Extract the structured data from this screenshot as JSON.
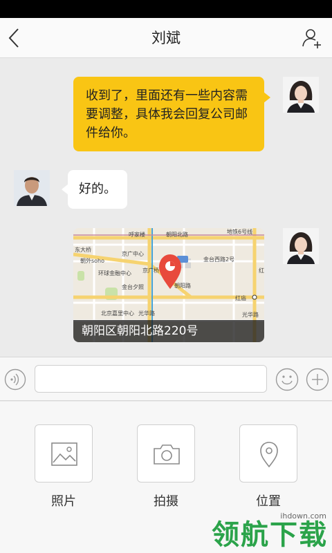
{
  "header": {
    "title": "刘斌"
  },
  "messages": [
    {
      "side": "right",
      "text": "收到了，里面还有一些内容需要调整，具体我会回复公司邮件给你。"
    },
    {
      "side": "left",
      "text": "好的。"
    },
    {
      "side": "right",
      "type": "location",
      "caption": "朝阳区朝阳北路220号"
    }
  ],
  "map_labels": {
    "l1": "呼家楼",
    "l2": "朝阳北路",
    "l3": "地铁6号线",
    "l4": "东大桥",
    "l5": "朝外soho",
    "l6": "京广中心",
    "l7": "金台西路2号",
    "l8": "环球金融中心",
    "l9": "京广桥",
    "l10": "金台夕照",
    "l11": "北京嘉里中心",
    "l12": "光华路",
    "l13": "红庙",
    "l14": "朝阳路",
    "l15": "红",
    "l16": "光华路"
  },
  "input": {
    "value": "",
    "placeholder": ""
  },
  "panel": {
    "photo_label": "照片",
    "camera_label": "拍摄",
    "location_label": "位置"
  },
  "watermark": {
    "url": "ihdown.com",
    "text": "领航下载"
  },
  "colors": {
    "accent_yellow": "#f9c514",
    "pin_red": "#e84a3c",
    "watermark_green": "#2ba34a"
  }
}
